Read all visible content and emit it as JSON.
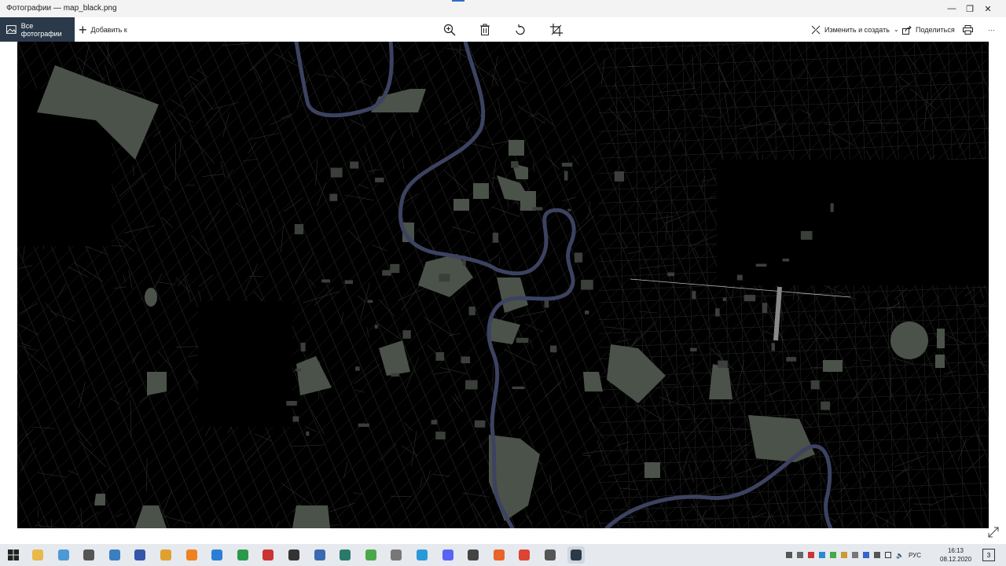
{
  "window": {
    "title": "Фотографии — map_black.png",
    "minimize_glyph": "—",
    "maximize_glyph": "❐",
    "close_glyph": "✕"
  },
  "toolbar": {
    "all_photos_label": "Все фотографии",
    "add_to_label": "Добавить к",
    "edit_create_label": "Изменить и создать",
    "share_label": "Поделиться",
    "more_glyph": "···"
  },
  "taskbar": {
    "apps": [
      "file-explorer",
      "notepad",
      "calculator",
      "app-4",
      "app-5",
      "app-6",
      "sublime-text",
      "vscode",
      "pycharm",
      "filezilla",
      "terminal",
      "app-12",
      "app-13",
      "utorrent",
      "app-15",
      "telegram",
      "discord",
      "app-18",
      "firefox",
      "chrome",
      "app-21",
      "photos"
    ],
    "language": "РУС",
    "time": "16:13",
    "date": "08.12.2020",
    "notification_count": "3"
  },
  "colors": {
    "titlebar_bg": "#f3f3f3",
    "all_photos_bg": "#2b3a4a",
    "map_bg": "#000000",
    "river": "#3c4260",
    "parks": "#4a524a",
    "streets": "#2a2a2a",
    "taskbar_bg": "#e6e9ee"
  }
}
